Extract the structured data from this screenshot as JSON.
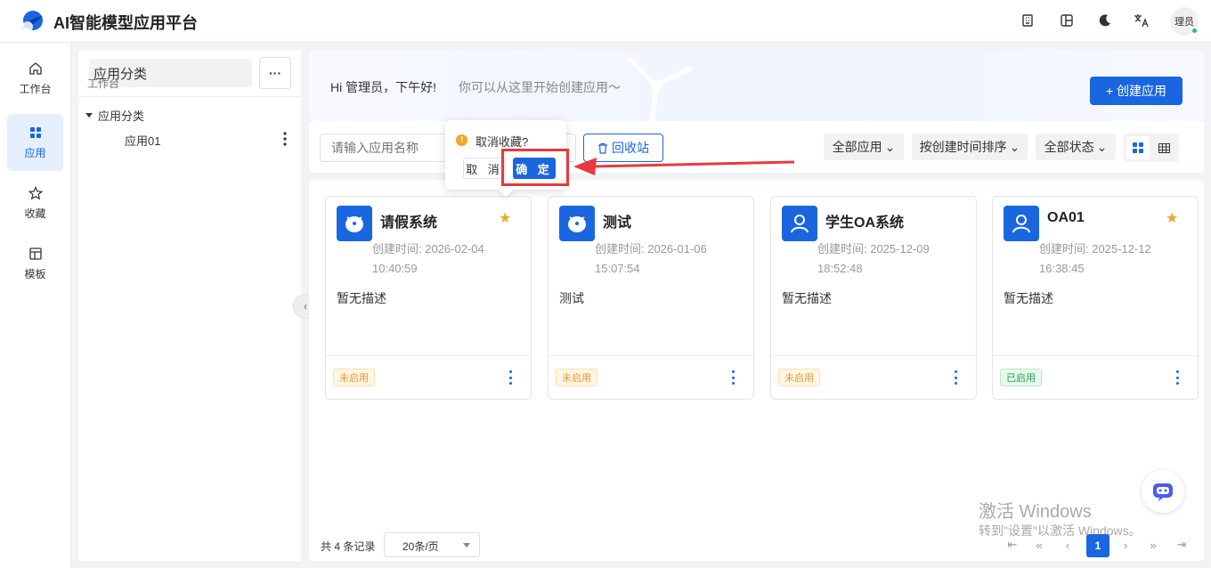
{
  "header": {
    "app_title": "AI智能模型应用平台",
    "icons": [
      "building-icon",
      "layout-icon",
      "moon-icon",
      "translate-icon"
    ],
    "user_avatar": "理员"
  },
  "nav": {
    "items": [
      {
        "label": "工作台",
        "icon": "home-icon",
        "active": false
      },
      {
        "label": "应用",
        "icon": "grid-icon",
        "active": true
      },
      {
        "label": "收藏",
        "icon": "star-icon",
        "active": false
      },
      {
        "label": "模板",
        "icon": "template-icon",
        "active": false
      }
    ]
  },
  "category": {
    "header": "应用分类",
    "ghost": "工作台",
    "more": "···",
    "tree": {
      "root": "应用分类",
      "children": [
        "应用01"
      ]
    }
  },
  "banner": {
    "greeting": "Hi 管理员，下午好!",
    "subtitle": "你可以从这里开始创建应用～",
    "create_button": "+ 创建应用"
  },
  "filters": {
    "search_placeholder": "请输入应用名称",
    "recycle_button": "回收站",
    "all_apps": "全部应用",
    "sort": "按创建时间排序",
    "all_status": "全部状态"
  },
  "cards": [
    {
      "name": "请假系统",
      "icon": "robot-icon",
      "starred": true,
      "time_label": "创建时间: 2026-02-04",
      "time_clock": "10:40:59",
      "desc": "暂无描述",
      "status": "未启用",
      "enabled": false
    },
    {
      "name": "测试",
      "icon": "robot-icon",
      "starred": false,
      "time_label": "创建时间: 2026-01-06",
      "time_clock": "15:07:54",
      "desc": "测试",
      "status": "未启用",
      "enabled": false
    },
    {
      "name": "学生OA系统",
      "icon": "user-icon",
      "starred": false,
      "time_label": "创建时间: 2025-12-09",
      "time_clock": "18:52:48",
      "desc": "暂无描述",
      "status": "未启用",
      "enabled": false
    },
    {
      "name": "OA01",
      "icon": "user-icon",
      "starred": true,
      "time_label": "创建时间: 2025-12-12",
      "time_clock": "16:38:45",
      "desc": "暂无描述",
      "status": "已启用",
      "enabled": true
    }
  ],
  "pagination": {
    "total": "共 4 条记录",
    "page_size": "20条/页",
    "current_page": "1"
  },
  "popconfirm": {
    "question": "取消收藏?",
    "cancel": "取 消",
    "confirm": "确 定"
  },
  "watermark": {
    "line1": "激活 Windows",
    "line2": "转到\"设置\"以激活 Windows。"
  },
  "colors": {
    "accent": "#1a66e0",
    "star": "#f5a623",
    "annotation": "#e8393e"
  }
}
